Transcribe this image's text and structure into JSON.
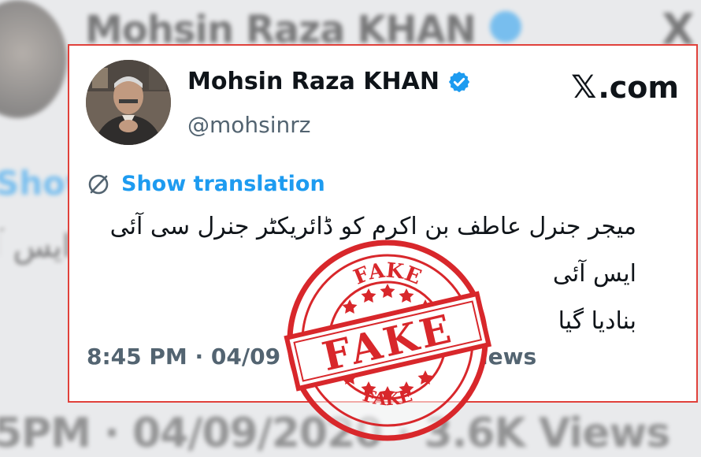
{
  "backdrop": {
    "name": "Mohsin Raza KHAN",
    "x_letter": "X",
    "show": "Show",
    "urdu_fragment": "ایس آئی",
    "meta": "5PM · 04/09/2020 · 3.6K Views"
  },
  "tweet": {
    "display_name": "Mohsin Raza KHAN",
    "handle": "@mohsinrz",
    "source": {
      "glyph": "𝕏",
      "text": ".com"
    },
    "show_translation": "Show translation",
    "text_line1": "میجر جنرل عاطف بن اکرم کو ڈائریکٹر جنرل سی آئی ایس آئی",
    "text_line2": "بنادیا گیا",
    "meta": "8:45 PM · 04/09",
    "views": "iews"
  },
  "stamp": {
    "top_text": "FAKE",
    "main_text": "FAKE",
    "bottom_text": "FAKE",
    "color": "#d8272b"
  },
  "colors": {
    "accent": "#1d9bf0",
    "border": "#e0413b",
    "text": "#0f1419",
    "muted": "#536471"
  },
  "icons": [
    "verified-badge-icon",
    "translate-globe-icon",
    "x-logo-icon",
    "star-icon"
  ]
}
